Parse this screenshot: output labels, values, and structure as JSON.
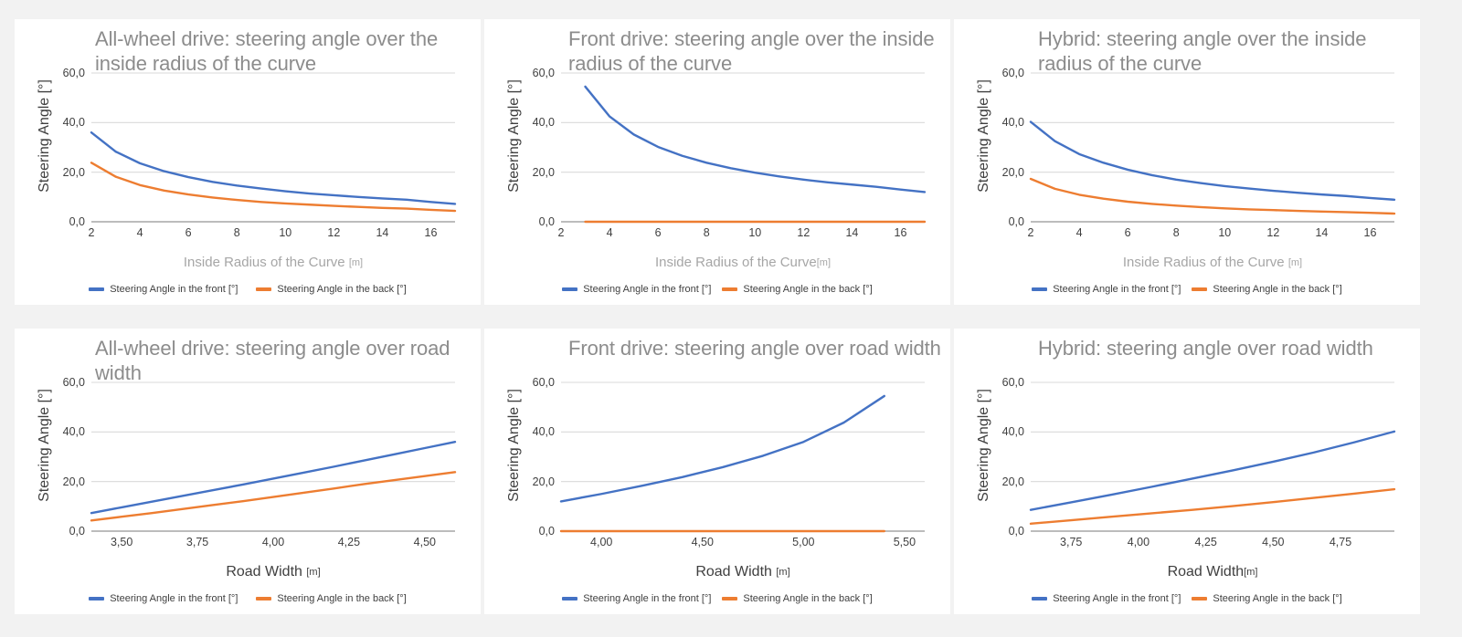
{
  "page": {
    "background_color": "#f2f2f2",
    "card_color": "#ffffff"
  },
  "series_colors": {
    "front": "#4472c4",
    "back": "#ed7d31"
  },
  "common": {
    "y_axis_label": "Steering Angle [°]",
    "y_ticks": [
      "0,0",
      "20,0",
      "40,0",
      "60,0"
    ],
    "legend_front": "Steering Angle in the front [°]",
    "legend_back": "Steering Angle in the back [°]",
    "x_label_radius": "Inside Radius of the Curve ",
    "x_label_width": "Road Width ",
    "unit_m": "[m]"
  },
  "charts": [
    {
      "id": "awd-radius",
      "title": "All-wheel drive: steering angle over the inside radius of the curve",
      "x_label": "Inside Radius of the Curve ",
      "x_unit": "[m]",
      "x_ticks": [
        "2",
        "4",
        "6",
        "8",
        "10",
        "12",
        "14",
        "16"
      ]
    },
    {
      "id": "front-radius",
      "title": "Front drive: steering angle over the inside radius of the curve",
      "x_label": "Inside Radius of the Curve",
      "x_unit": "[m]",
      "x_ticks": [
        "2",
        "4",
        "6",
        "8",
        "10",
        "12",
        "14",
        "16"
      ]
    },
    {
      "id": "hybrid-radius",
      "title": "Hybrid: steering angle over the inside radius of the curve",
      "x_label": "Inside Radius of the Curve ",
      "x_unit": "[m]",
      "x_ticks": [
        "2",
        "4",
        "6",
        "8",
        "10",
        "12",
        "14",
        "16"
      ]
    },
    {
      "id": "awd-width",
      "title": "All-wheel drive: steering angle over road width",
      "x_label": "Road Width ",
      "x_unit": "[m]",
      "x_ticks": [
        "3,50",
        "3,75",
        "4,00",
        "4,25",
        "4,50"
      ]
    },
    {
      "id": "front-width",
      "title": "Front drive: steering angle over road width",
      "x_label": "Road Width ",
      "x_unit": "[m]",
      "x_ticks": [
        "4,00",
        "4,50",
        "5,00",
        "5,50"
      ]
    },
    {
      "id": "hybrid-width",
      "title": "Hybrid: steering angle over road width",
      "x_label": "Road Width",
      "x_unit": "[m]",
      "x_ticks": [
        "3,75",
        "4,00",
        "4,25",
        "4,50",
        "4,75"
      ]
    }
  ],
  "chart_data": [
    {
      "type": "line",
      "title": "All-wheel drive: steering angle over the inside radius of the curve",
      "xlabel": "Inside Radius of the Curve [m]",
      "ylabel": "Steering Angle [°]",
      "xlim": [
        2,
        17
      ],
      "ylim": [
        0,
        60
      ],
      "xticks": [
        2,
        4,
        6,
        8,
        10,
        12,
        14,
        16
      ],
      "yticks": [
        0,
        20,
        40,
        60
      ],
      "grid": true,
      "legend": "bottom",
      "x": [
        2,
        3,
        4,
        5,
        6,
        7,
        8,
        9,
        10,
        11,
        12,
        13,
        14,
        15,
        16,
        17
      ],
      "series": [
        {
          "name": "Steering Angle in the front [°]",
          "color": "#4472c4",
          "values": [
            36.0,
            28.3,
            23.6,
            20.4,
            18.0,
            16.1,
            14.6,
            13.4,
            12.3,
            11.4,
            10.7,
            10.0,
            9.4,
            8.9,
            8.0,
            7.2
          ]
        },
        {
          "name": "Steering Angle in the back [°]",
          "color": "#ed7d31",
          "values": [
            23.8,
            18.2,
            14.8,
            12.6,
            11.0,
            9.8,
            8.8,
            8.0,
            7.4,
            6.9,
            6.4,
            6.0,
            5.6,
            5.3,
            4.8,
            4.4
          ]
        }
      ]
    },
    {
      "type": "line",
      "title": "Front drive: steering angle over the inside radius of the curve",
      "xlabel": "Inside Radius of the Curve [m]",
      "ylabel": "Steering Angle [°]",
      "xlim": [
        2,
        17
      ],
      "ylim": [
        0,
        60
      ],
      "xticks": [
        2,
        4,
        6,
        8,
        10,
        12,
        14,
        16
      ],
      "yticks": [
        0,
        20,
        40,
        60
      ],
      "grid": true,
      "legend": "bottom",
      "x": [
        3,
        4,
        5,
        6,
        7,
        8,
        9,
        10,
        11,
        12,
        13,
        14,
        15,
        16,
        17
      ],
      "series": [
        {
          "name": "Steering Angle in the front [°]",
          "color": "#4472c4",
          "values": [
            54.5,
            42.5,
            35.2,
            30.2,
            26.6,
            23.8,
            21.6,
            19.8,
            18.3,
            17.0,
            15.9,
            15.0,
            14.1,
            13.0,
            12.0
          ]
        },
        {
          "name": "Steering Angle in the back [°]",
          "color": "#ed7d31",
          "values": [
            0,
            0,
            0,
            0,
            0,
            0,
            0,
            0,
            0,
            0,
            0,
            0,
            0,
            0,
            0
          ]
        }
      ]
    },
    {
      "type": "line",
      "title": "Hybrid: steering angle over the inside radius of the curve",
      "xlabel": "Inside Radius of the Curve [m]",
      "ylabel": "Steering Angle [°]",
      "xlim": [
        2,
        17
      ],
      "ylim": [
        0,
        60
      ],
      "xticks": [
        2,
        4,
        6,
        8,
        10,
        12,
        14,
        16
      ],
      "yticks": [
        0,
        20,
        40,
        60
      ],
      "grid": true,
      "legend": "bottom",
      "x": [
        2,
        3,
        4,
        5,
        6,
        7,
        8,
        9,
        10,
        11,
        12,
        13,
        14,
        15,
        16,
        17
      ],
      "series": [
        {
          "name": "Steering Angle in the front [°]",
          "color": "#4472c4",
          "values": [
            40.3,
            32.5,
            27.3,
            23.8,
            21.0,
            18.8,
            17.0,
            15.6,
            14.4,
            13.4,
            12.5,
            11.7,
            11.0,
            10.4,
            9.6,
            8.9
          ]
        },
        {
          "name": "Steering Angle in the back [°]",
          "color": "#ed7d31",
          "values": [
            17.3,
            13.3,
            10.9,
            9.3,
            8.1,
            7.2,
            6.5,
            5.9,
            5.4,
            5.0,
            4.7,
            4.4,
            4.1,
            3.9,
            3.6,
            3.3
          ]
        }
      ]
    },
    {
      "type": "line",
      "title": "All-wheel drive: steering angle over road width",
      "xlabel": "Road Width [m]",
      "ylabel": "Steering Angle [°]",
      "xlim": [
        3.4,
        4.6
      ],
      "ylim": [
        0,
        60
      ],
      "xticks": [
        3.5,
        3.75,
        4.0,
        4.25,
        4.5
      ],
      "yticks": [
        0,
        20,
        40,
        60
      ],
      "grid": true,
      "legend": "bottom",
      "x": [
        3.4,
        3.5,
        3.6,
        3.7,
        3.8,
        3.9,
        4.0,
        4.1,
        4.2,
        4.3,
        4.4,
        4.5,
        4.6
      ],
      "series": [
        {
          "name": "Steering Angle in the front [°]",
          "color": "#4472c4",
          "values": [
            7.3,
            9.6,
            11.9,
            14.2,
            16.5,
            18.8,
            21.2,
            23.6,
            26.0,
            28.5,
            31.0,
            33.5,
            36.0
          ]
        },
        {
          "name": "Steering Angle in the back [°]",
          "color": "#ed7d31",
          "values": [
            4.3,
            5.8,
            7.3,
            8.9,
            10.5,
            12.1,
            13.8,
            15.5,
            17.2,
            19.0,
            20.6,
            22.2,
            23.8
          ]
        }
      ]
    },
    {
      "type": "line",
      "title": "Front drive: steering angle over road width",
      "xlabel": "Road Width [m]",
      "ylabel": "Steering Angle [°]",
      "xlim": [
        3.8,
        5.6
      ],
      "ylim": [
        0,
        60
      ],
      "xticks": [
        4.0,
        4.5,
        5.0,
        5.5
      ],
      "yticks": [
        0,
        20,
        40,
        60
      ],
      "grid": true,
      "legend": "bottom",
      "x": [
        3.8,
        4.0,
        4.2,
        4.4,
        4.6,
        4.8,
        5.0,
        5.2,
        5.4
      ],
      "series": [
        {
          "name": "Steering Angle in the front [°]",
          "color": "#4472c4",
          "values": [
            12.0,
            15.0,
            18.3,
            21.8,
            25.8,
            30.4,
            36.0,
            43.8,
            54.5
          ]
        },
        {
          "name": "Steering Angle in the back [°]",
          "color": "#ed7d31",
          "values": [
            0,
            0,
            0,
            0,
            0,
            0,
            0,
            0,
            0
          ]
        }
      ]
    },
    {
      "type": "line",
      "title": "Hybrid: steering angle over road width",
      "xlabel": "Road Width [m]",
      "ylabel": "Steering Angle [°]",
      "xlim": [
        3.6,
        4.95
      ],
      "ylim": [
        0,
        60
      ],
      "xticks": [
        3.75,
        4.0,
        4.25,
        4.5,
        4.75
      ],
      "yticks": [
        0,
        20,
        40,
        60
      ],
      "grid": true,
      "legend": "bottom",
      "x": [
        3.6,
        3.75,
        3.9,
        4.05,
        4.2,
        4.35,
        4.5,
        4.65,
        4.8,
        4.95
      ],
      "series": [
        {
          "name": "Steering Angle in the front [°]",
          "color": "#4472c4",
          "values": [
            8.6,
            11.6,
            14.7,
            17.9,
            21.2,
            24.5,
            28.0,
            31.7,
            35.8,
            40.2
          ]
        },
        {
          "name": "Steering Angle in the back [°]",
          "color": "#ed7d31",
          "values": [
            3.0,
            4.4,
            5.8,
            7.2,
            8.6,
            10.1,
            11.7,
            13.4,
            15.1,
            16.9
          ]
        }
      ]
    }
  ]
}
